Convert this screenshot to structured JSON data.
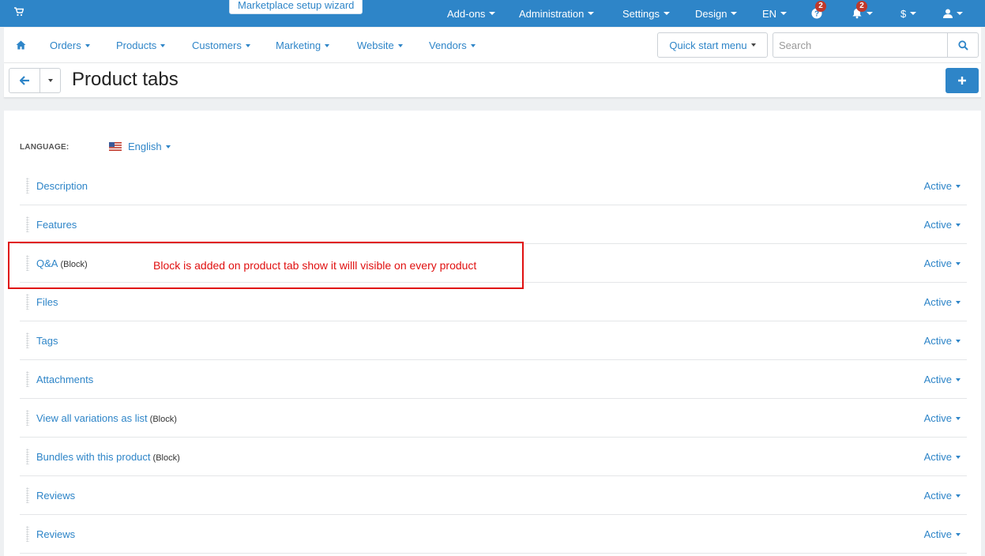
{
  "topbar": {
    "cart_icon": "shopping-cart-icon",
    "wizard_label": "Marketplace setup wizard",
    "menu": {
      "addons": "Add-ons",
      "administration": "Administration",
      "settings": "Settings",
      "design": "Design",
      "language": "EN",
      "help_badge": "2",
      "notifications_badge": "2",
      "currency": "$"
    },
    "colors": {
      "bar": "#2e85c8",
      "badge": "#c0392b"
    }
  },
  "nav": {
    "home_icon": "home-icon",
    "items": [
      "Orders",
      "Products",
      "Customers",
      "Marketing",
      "Website",
      "Vendors"
    ],
    "quick_start": "Quick start menu",
    "search_placeholder": "Search"
  },
  "header": {
    "title": "Product tabs"
  },
  "content": {
    "language_label": "LANGUAGE:",
    "language_value": "English",
    "tabs": [
      {
        "name": "Description",
        "block": "",
        "status": "Active"
      },
      {
        "name": "Features",
        "block": "",
        "status": "Active"
      },
      {
        "name": "Q&A",
        "block": "(Block)",
        "status": "Active"
      },
      {
        "name": "Files",
        "block": "",
        "status": "Active"
      },
      {
        "name": "Tags",
        "block": "",
        "status": "Active"
      },
      {
        "name": "Attachments",
        "block": "",
        "status": "Active"
      },
      {
        "name": "View all variations as list",
        "block": "(Block)",
        "status": "Active"
      },
      {
        "name": "Bundles with this product",
        "block": "(Block)",
        "status": "Active"
      },
      {
        "name": "Reviews",
        "block": "",
        "status": "Active"
      },
      {
        "name": "Reviews",
        "block": "",
        "status": "Active"
      }
    ]
  },
  "annotation": {
    "text": "Block is added on product tab show it willl visible on every product",
    "color": "#e01010"
  }
}
